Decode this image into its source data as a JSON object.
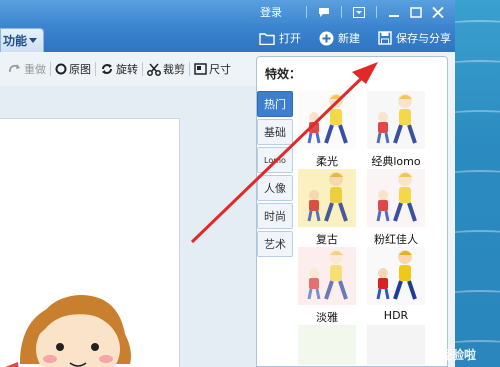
{
  "window": {
    "login_label": "登录",
    "menu_button_label": "功能"
  },
  "top_actions": [
    {
      "label": "打开",
      "icon": "folder-icon"
    },
    {
      "label": "新建",
      "icon": "plus-circle-icon"
    },
    {
      "label": "保存与分享",
      "icon": "save-icon"
    }
  ],
  "toolbar": {
    "redo_label": "重做",
    "original_label": "原图",
    "rotate_label": "旋转",
    "crop_label": "裁剪",
    "size_label": "尺寸"
  },
  "effects_panel": {
    "title": "特效：",
    "categories": [
      {
        "label": "热门",
        "active": true
      },
      {
        "label": "基础",
        "active": false
      },
      {
        "label": "Lomo",
        "active": false
      },
      {
        "label": "人像",
        "active": false
      },
      {
        "label": "时尚",
        "active": false
      },
      {
        "label": "艺术",
        "active": false
      }
    ],
    "effects": [
      {
        "label": "柔光"
      },
      {
        "label": "经典lomo"
      },
      {
        "label": "复古"
      },
      {
        "label": "粉红佳人"
      },
      {
        "label": "淡雅"
      },
      {
        "label": "HDR"
      }
    ]
  },
  "watermark": "经验啦"
}
